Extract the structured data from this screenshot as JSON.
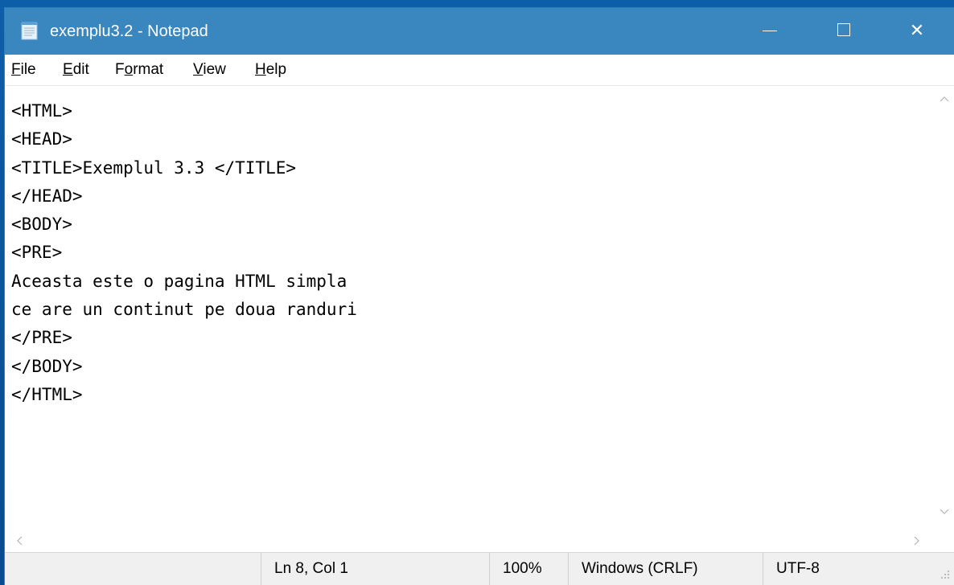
{
  "window": {
    "title": "exemplu3.2 - Notepad",
    "controls": {
      "minimize_icon": "minimize-icon",
      "maximize_icon": "maximize-icon",
      "close_icon": "close-icon",
      "close_glyph": "✕"
    }
  },
  "menu": {
    "file": {
      "accel": "F",
      "rest": "ile"
    },
    "edit": {
      "accel": "E",
      "rest": "dit"
    },
    "format": {
      "pre": "F",
      "accel": "o",
      "rest": "rmat"
    },
    "view": {
      "accel": "V",
      "rest": "iew"
    },
    "help": {
      "accel": "H",
      "rest": "elp"
    }
  },
  "editor": {
    "lines": [
      "<HTML>",
      "<HEAD>",
      "<TITLE>Exemplul 3.3 </TITLE>",
      "</HEAD>",
      "<BODY>",
      "<PRE>",
      "Aceasta este o pagina HTML simpla",
      "ce are un continut pe doua randuri",
      "</PRE>",
      "</BODY>",
      "</HTML>"
    ]
  },
  "statusbar": {
    "position": "Ln 8, Col 1",
    "zoom": "100%",
    "line_ending": "Windows (CRLF)",
    "encoding": "UTF-8"
  },
  "colors": {
    "titlebar": "#3a86be",
    "desktop": "#0a4f95",
    "statusbar": "#f0f0f0"
  }
}
